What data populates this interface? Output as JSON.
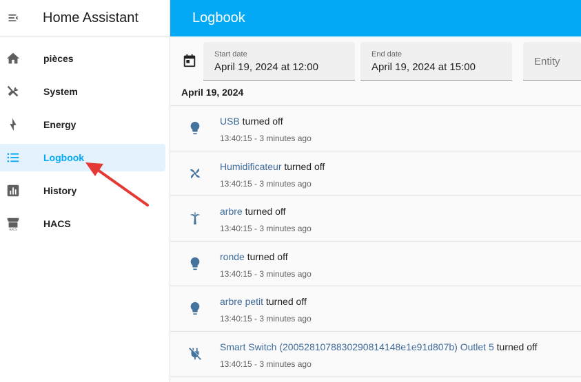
{
  "app": {
    "title": "Home Assistant"
  },
  "sidebar": {
    "items": [
      {
        "label": "pièces",
        "icon": "home-icon",
        "active": false
      },
      {
        "label": "System",
        "icon": "tools-icon",
        "active": false
      },
      {
        "label": "Energy",
        "icon": "lightning-bolt-icon",
        "active": false
      },
      {
        "label": "Logbook",
        "icon": "list-icon",
        "active": true
      },
      {
        "label": "History",
        "icon": "chart-box-icon",
        "active": false
      },
      {
        "label": "HACS",
        "icon": "hacs-store-icon",
        "active": false
      }
    ]
  },
  "header": {
    "title": "Logbook"
  },
  "filters": {
    "start": {
      "label": "Start date",
      "value": "April 19, 2024 at 12:00"
    },
    "end": {
      "label": "End date",
      "value": "April 19, 2024 at 15:00"
    },
    "entity": {
      "placeholder": "Entity"
    }
  },
  "date_heading": "April 19, 2024",
  "entries": [
    {
      "name": "USB",
      "action": " turned off",
      "time": "13:40:15 - 3 minutes ago",
      "icon": "lightbulb-icon"
    },
    {
      "name": "Humidificateur",
      "action": " turned off",
      "time": "13:40:15 - 3 minutes ago",
      "icon": "fan-icon"
    },
    {
      "name": "arbre",
      "action": " turned off",
      "time": "13:40:15 - 3 minutes ago",
      "icon": "palm-tree-icon"
    },
    {
      "name": "ronde",
      "action": " turned off",
      "time": "13:40:15 - 3 minutes ago",
      "icon": "lightbulb-icon"
    },
    {
      "name": "arbre petit",
      "action": " turned off",
      "time": "13:40:15 - 3 minutes ago",
      "icon": "lightbulb-icon"
    },
    {
      "name": "Smart Switch (2005281078830290814148e1e91d807b) Outlet 5",
      "action": " turned off",
      "time": "13:40:15 - 3 minutes ago",
      "icon": "power-plug-off-icon"
    }
  ],
  "colors": {
    "accent": "#03a9f4",
    "icon": "#44739e",
    "active_bg": "#e3f2fd",
    "annotation": "#e53935"
  }
}
